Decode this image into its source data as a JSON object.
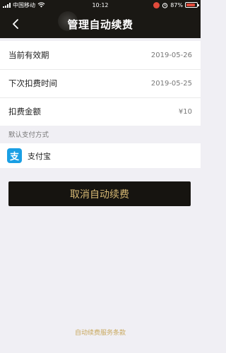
{
  "status_bar": {
    "carrier": "中国移动",
    "time": "10:12",
    "battery_percent": "87%",
    "battery_level": 0.87
  },
  "nav": {
    "back_icon": "chevron-left-icon",
    "title": "管理自动续费"
  },
  "details": [
    {
      "label": "当前有效期",
      "value": "2019-05-26"
    },
    {
      "label": "下次扣费时间",
      "value": "2019-05-25"
    },
    {
      "label": "扣费金额",
      "value": "¥10"
    }
  ],
  "payment": {
    "section_label": "默认支付方式",
    "method_name": "支付宝",
    "method_icon_glyph": "支"
  },
  "actions": {
    "cancel_label": "取消自动续费"
  },
  "footer": {
    "terms_link": "自动续费服务条款"
  },
  "colors": {
    "header_bg": "#1a1814",
    "button_gold": "#d6b873",
    "alipay_blue": "#1a9fe4"
  }
}
